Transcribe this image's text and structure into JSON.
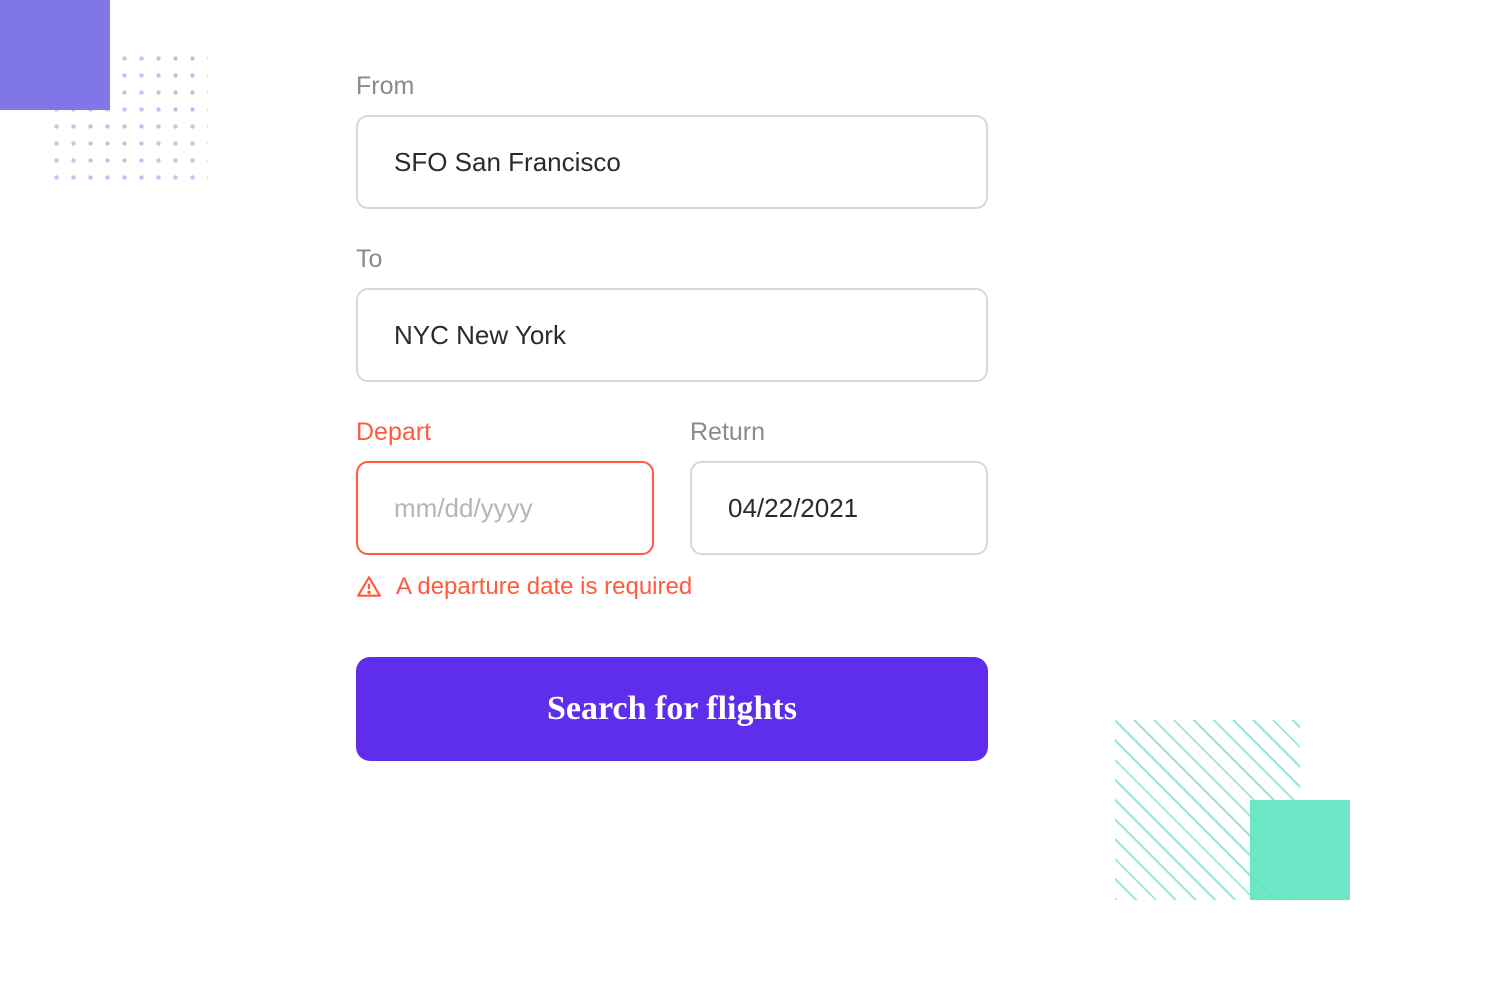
{
  "form": {
    "from": {
      "label": "From",
      "value": "SFO San Francisco"
    },
    "to": {
      "label": "To",
      "value": "NYC New York"
    },
    "depart": {
      "label": "Depart",
      "value": "",
      "placeholder": "mm/dd/yyyy",
      "error": "A departure date is required"
    },
    "return": {
      "label": "Return",
      "value": "04/22/2021"
    },
    "submit_label": "Search for flights"
  },
  "colors": {
    "accent": "#5F2EEA",
    "error": "#FF5A3D",
    "teal": "#5DE4C0",
    "lavender": "#8176E8"
  }
}
